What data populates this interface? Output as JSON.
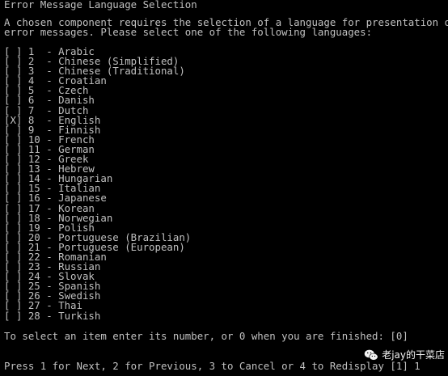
{
  "console": {
    "title": "Error Message Language Selection",
    "intro_line1": "A chosen component requires the selection of a language for presentation of",
    "intro_line2": "error messages. Please select one of the following languages:",
    "languages": [
      {
        "mark": "[ ]",
        "num": "1",
        "name": "Arabic"
      },
      {
        "mark": "[ ]",
        "num": "2",
        "name": "Chinese (Simplified)"
      },
      {
        "mark": "[ ]",
        "num": "3",
        "name": "Chinese (Traditional)"
      },
      {
        "mark": "[ ]",
        "num": "4",
        "name": "Croatian"
      },
      {
        "mark": "[ ]",
        "num": "5",
        "name": "Czech"
      },
      {
        "mark": "[ ]",
        "num": "6",
        "name": "Danish"
      },
      {
        "mark": "[ ]",
        "num": "7",
        "name": "Dutch"
      },
      {
        "mark": "[X]",
        "num": "8",
        "name": "English"
      },
      {
        "mark": "[ ]",
        "num": "9",
        "name": "Finnish"
      },
      {
        "mark": "[ ]",
        "num": "10",
        "name": "French"
      },
      {
        "mark": "[ ]",
        "num": "11",
        "name": "German"
      },
      {
        "mark": "[ ]",
        "num": "12",
        "name": "Greek"
      },
      {
        "mark": "[ ]",
        "num": "13",
        "name": "Hebrew"
      },
      {
        "mark": "[ ]",
        "num": "14",
        "name": "Hungarian"
      },
      {
        "mark": "[ ]",
        "num": "15",
        "name": "Italian"
      },
      {
        "mark": "[ ]",
        "num": "16",
        "name": "Japanese"
      },
      {
        "mark": "[ ]",
        "num": "17",
        "name": "Korean"
      },
      {
        "mark": "[ ]",
        "num": "18",
        "name": "Norwegian"
      },
      {
        "mark": "[ ]",
        "num": "19",
        "name": "Polish"
      },
      {
        "mark": "[ ]",
        "num": "20",
        "name": "Portuguese (Brazilian)"
      },
      {
        "mark": "[ ]",
        "num": "21",
        "name": "Portuguese (European)"
      },
      {
        "mark": "[ ]",
        "num": "22",
        "name": "Romanian"
      },
      {
        "mark": "[ ]",
        "num": "23",
        "name": "Russian"
      },
      {
        "mark": "[ ]",
        "num": "24",
        "name": "Slovak"
      },
      {
        "mark": "[ ]",
        "num": "25",
        "name": "Spanish"
      },
      {
        "mark": "[ ]",
        "num": "26",
        "name": "Swedish"
      },
      {
        "mark": "[ ]",
        "num": "27",
        "name": "Thai"
      },
      {
        "mark": "[ ]",
        "num": "28",
        "name": "Turkish"
      }
    ],
    "prompt": "To select an item enter its number, or 0 when you are finished: [0]",
    "footer": "Press 1 for Next, 2 for Previous, 3 to Cancel or 4 to Redisplay [1] 1"
  },
  "watermark": {
    "text": "老jay的干菜店",
    "icon": "wechat-icon"
  },
  "colors": {
    "background": "#000000",
    "text": "#c0c0c0"
  }
}
